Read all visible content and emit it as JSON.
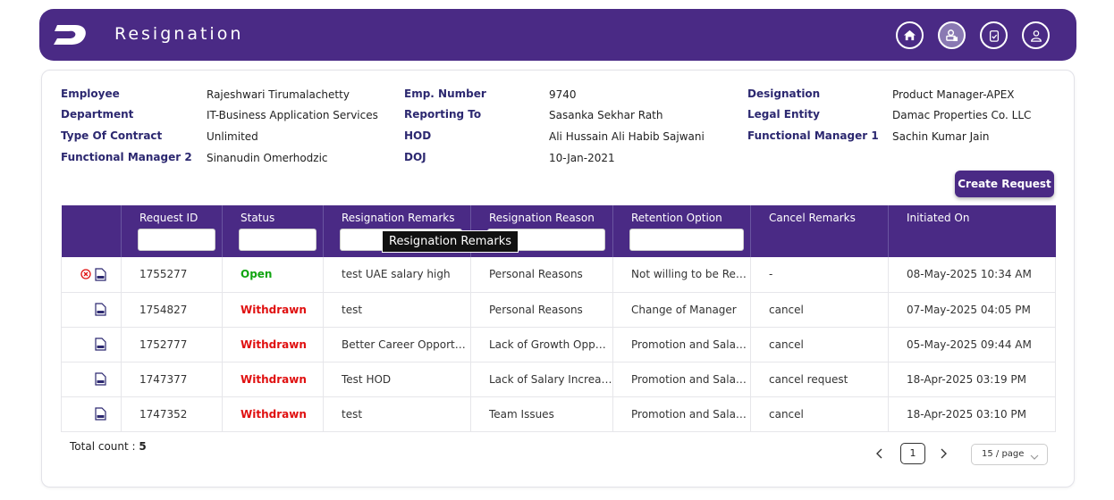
{
  "header": {
    "title": "Resignation",
    "icons": [
      "home-icon",
      "user-badge-icon",
      "clipboard-icon",
      "profile-icon"
    ]
  },
  "employee_info": [
    {
      "label": "Employee",
      "value": "Rajeshwari Tirumalachetty"
    },
    {
      "label": "Department",
      "value": "IT-Business Application Services"
    },
    {
      "label": "Type Of Contract",
      "value": "Unlimited"
    },
    {
      "label": "Functional Manager 2",
      "value": "Sinanudin Omerhodzic"
    },
    {
      "label": "Emp. Number",
      "value": "9740"
    },
    {
      "label": "Reporting To",
      "value": "Sasanka Sekhar Rath"
    },
    {
      "label": "HOD",
      "value": "Ali Hussain Ali Habib Sajwani"
    },
    {
      "label": "DOJ",
      "value": "10-Jan-2021"
    },
    {
      "label": "Designation",
      "value": "Product Manager-APEX"
    },
    {
      "label": "Legal Entity",
      "value": "Damac Properties Co. LLC"
    },
    {
      "label": "Functional Manager 1",
      "value": "Sachin Kumar Jain"
    }
  ],
  "create_button": "Create Request",
  "table": {
    "columns": [
      "",
      "Request ID",
      "Status",
      "Resignation Remarks",
      "Resignation Reason",
      "Retention Option",
      "Cancel Remarks",
      "Initiated On"
    ],
    "rows": [
      {
        "id": "1755277",
        "status": "Open",
        "remarks": "test UAE salary high",
        "reason": "Personal Reasons",
        "retention": "Not willing to be Retained",
        "cancel": "-",
        "initiated": "08-May-2025 10:34 AM"
      },
      {
        "id": "1754827",
        "status": "Withdrawn",
        "remarks": "test",
        "reason": "Personal Reasons",
        "retention": "Change of Manager",
        "cancel": "cancel",
        "initiated": "07-May-2025 04:05 PM"
      },
      {
        "id": "1752777",
        "status": "Withdrawn",
        "remarks": "Better Career Opportunity",
        "reason": "Lack of Growth Opportunity",
        "retention": "Promotion and Salary Increase",
        "cancel": "cancel",
        "initiated": "05-May-2025 09:44 AM"
      },
      {
        "id": "1747377",
        "status": "Withdrawn",
        "remarks": "Test HOD",
        "reason": "Lack of Salary Increase",
        "retention": "Promotion and Salary Increase",
        "cancel": "cancel request",
        "initiated": "18-Apr-2025 03:19 PM"
      },
      {
        "id": "1747352",
        "status": "Withdrawn",
        "remarks": "test",
        "reason": "Team Issues",
        "retention": "Promotion and Salary Increase",
        "cancel": "cancel",
        "initiated": "18-Apr-2025 03:10 PM"
      }
    ]
  },
  "tooltip": "Resignation Remarks",
  "footer": {
    "total_label": "Total count :",
    "total_value": "5",
    "page": "1",
    "page_size": "15 / page"
  },
  "colors": {
    "primary": "#4a2a85",
    "open": "#11a511",
    "withdrawn": "#e01010",
    "label": "#2c2870"
  }
}
